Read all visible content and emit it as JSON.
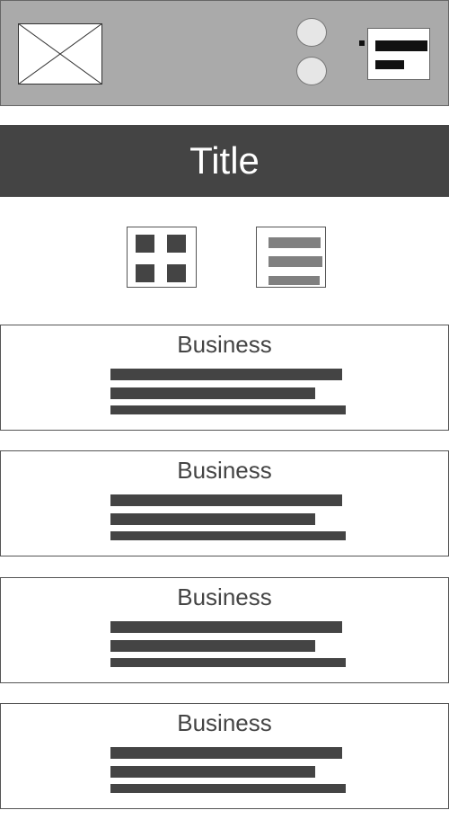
{
  "header": {
    "logo_icon": "image-placeholder-icon",
    "buttons": [
      "circle-button",
      "circle-button"
    ],
    "menu_icon": "menu-icon"
  },
  "title_bar": {
    "title": "Title"
  },
  "view_toggles": {
    "grid_icon": "grid-view-icon",
    "list_icon": "list-view-icon"
  },
  "cards": [
    {
      "title": "Business"
    },
    {
      "title": "Business"
    },
    {
      "title": "Business"
    },
    {
      "title": "Business"
    }
  ],
  "colors": {
    "header_bg": "#aaaaaa",
    "title_bar_bg": "#444444",
    "text_dark": "#444444"
  }
}
